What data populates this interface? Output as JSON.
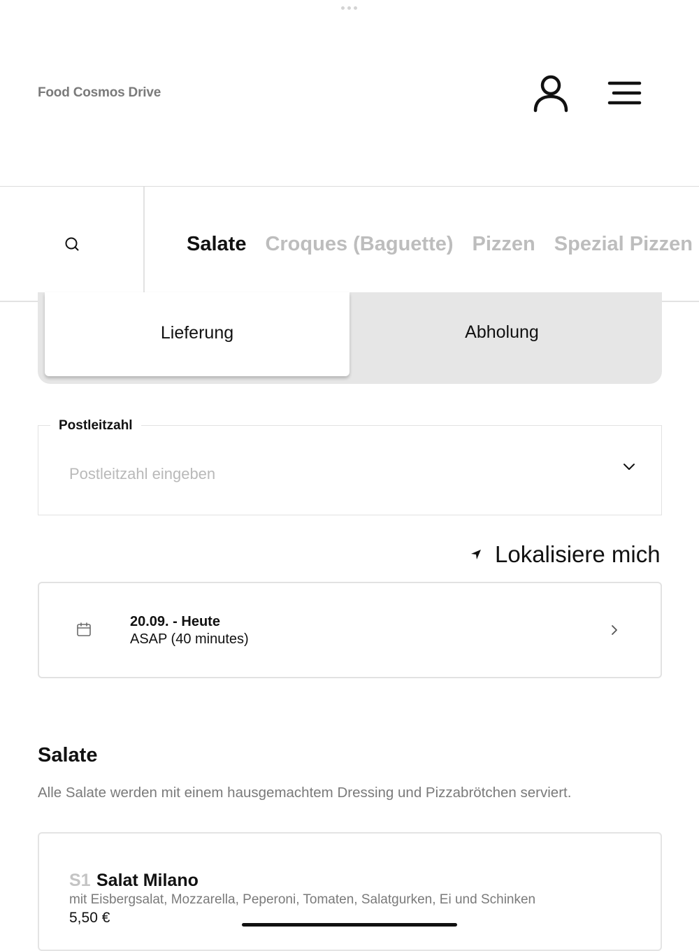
{
  "header": {
    "brand": "Food Cosmos Drive",
    "icons": {
      "account": "user-icon",
      "menu": "hamburger-menu-icon"
    }
  },
  "category_bar": {
    "search_icon": "search-icon",
    "categories": [
      {
        "label": "Salate",
        "active": true
      },
      {
        "label": "Croques (Baguette)",
        "active": false
      },
      {
        "label": "Pizzen",
        "active": false
      },
      {
        "label": "Spezial Pizzen",
        "active": false
      }
    ]
  },
  "order_type": {
    "delivery": "Lieferung",
    "pickup": "Abholung",
    "selected": "Lieferung"
  },
  "postal_code": {
    "label": "Postleitzahl",
    "placeholder": "Postleitzahl eingeben",
    "value": ""
  },
  "locate": {
    "label": "Lokalisiere mich"
  },
  "schedule": {
    "date": "20.09. - Heute",
    "time": "ASAP (40 minutes)"
  },
  "section": {
    "title": "Salate",
    "description": "Alle Salate werden mit einem hausgemachtem Dressing und Pizzabrötchen serviert."
  },
  "items": [
    {
      "code": "S1",
      "name": "Salat Milano",
      "description": "mit Eisbergsalat, Mozzarella, Peperoni, Tomaten, Salatgurken, Ei und Schinken",
      "price": "5,50 €"
    }
  ],
  "colors": {
    "text": "#111111",
    "muted": "#7a7a7a",
    "inactive_tab": "#bdbdbd",
    "segment_bg": "#e6e6e6",
    "border": "#e2e2e2"
  }
}
